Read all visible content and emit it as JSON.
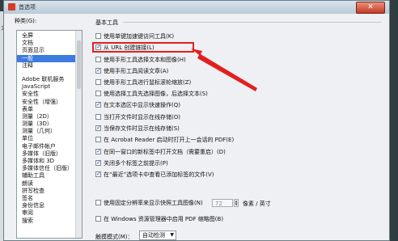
{
  "window": {
    "title": "首选项",
    "close_label": "✕",
    "background_hint": "文"
  },
  "sidebar": {
    "label": "种类(G):",
    "top_items": [
      "全屏",
      "文档",
      "页面显示",
      "一般",
      "注释"
    ],
    "items": [
      "Adobe 联机服务",
      "JavaScript",
      "安全性",
      "安全性（增强）",
      "表单",
      "测量（2D）",
      "测量（3D）",
      "测量（几何）",
      "单位",
      "电子邮件帐户",
      "多媒体（旧版）",
      "多媒体和 3D",
      "多媒体信任（旧版）",
      "辅助工具",
      "朗读",
      "拼写检查",
      "签名",
      "身份信息",
      "审阅",
      "搜索"
    ],
    "selected": "一般"
  },
  "main": {
    "section_title": "基本工具",
    "options": [
      {
        "label": "使用单键加速键访问工具(K)",
        "checked": false
      },
      {
        "label": "从 URL 创建链接(L)",
        "checked": true
      },
      {
        "label": "使用手形工具选择文本和图像(H)",
        "checked": false
      },
      {
        "label": "使用手形工具阅读文章(A)",
        "checked": true
      },
      {
        "label": "使用手形工具进行鼠标滚轮缩放(Z)",
        "checked": false
      },
      {
        "label": "使用选择工具先选择图像，后选择文本(S)",
        "checked": false
      },
      {
        "label": "在文本选区中显示快速操作(Q)",
        "checked": true
      },
      {
        "label": "当打开文件时显示在线存储(O)",
        "checked": false
      },
      {
        "label": "当保存文件时显示在线存储(S)",
        "checked": true
      },
      {
        "label": "在 Acrobat Reader 启动时打开上一会话的 PDF(E)",
        "checked": false
      },
      {
        "label": "在同一窗口的新标签中打开文档（需要重启）(D)",
        "checked": true
      },
      {
        "label": "关闭多个标签之前提示(P)",
        "checked": true
      },
      {
        "label": "在“最近”选项卡中查看已添加标签的文件(V)",
        "checked": true
      }
    ],
    "resolution": {
      "label": "使用固定分辨率来显示快照工具图像(N)",
      "checked": false,
      "value": "72",
      "unit": "像素 / 英寸"
    },
    "thumbnail": {
      "label": "在 Windows 资源管理器中启用 PDF 缩略图(B)",
      "checked": false
    },
    "tab_style": {
      "label": "触摸模式(M)：",
      "value": "自动检测"
    }
  }
}
